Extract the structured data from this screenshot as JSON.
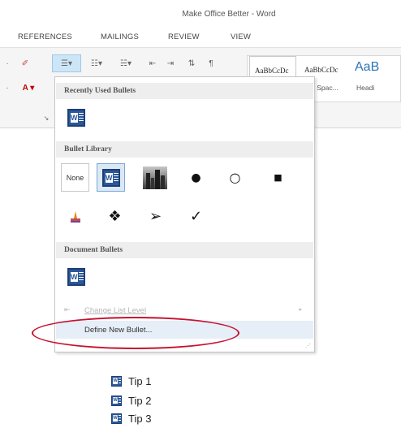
{
  "window": {
    "title": "Make Office Better - Word"
  },
  "menu": {
    "tabs": [
      "REFERENCES",
      "MAILINGS",
      "REVIEW",
      "VIEW"
    ]
  },
  "ribbon": {
    "styles": [
      {
        "sample": "AaBbCcDc",
        "name": ""
      },
      {
        "sample": "AaBbCcDc",
        "name": "No Spac..."
      },
      {
        "sample": "AaB",
        "name": "Headi"
      }
    ]
  },
  "dropdown": {
    "recent_header": "Recently Used Bullets",
    "library_header": "Bullet Library",
    "document_header": "Document Bullets",
    "none_label": "None",
    "change_list_level": "Change List Level",
    "define_new_bullet": "Define New Bullet...",
    "library_symbols": [
      "●",
      "○",
      "■",
      "❖",
      "➢",
      "✓"
    ]
  },
  "document": {
    "tips": [
      "Tip 1",
      "Tip 2",
      "Tip 3"
    ]
  },
  "colors": {
    "accent": "#2b579a",
    "highlight": "#c8102e"
  }
}
